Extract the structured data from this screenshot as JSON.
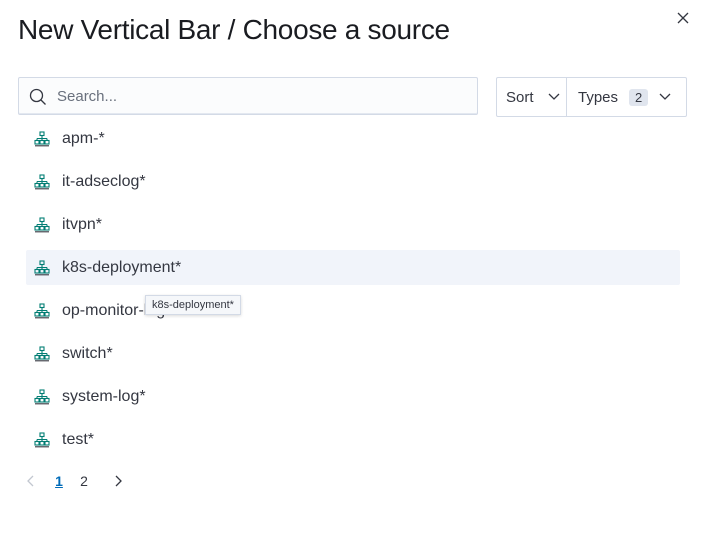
{
  "modal": {
    "title": "New Vertical Bar / Choose a source"
  },
  "search": {
    "placeholder": "Search...",
    "value": ""
  },
  "filters": {
    "sort_label": "Sort",
    "types_label": "Types",
    "types_count": "2"
  },
  "items": [
    {
      "label": "apm-*",
      "icon": "index-pattern-icon"
    },
    {
      "label": "it-adseclog*",
      "icon": "index-pattern-icon"
    },
    {
      "label": "itvpn*",
      "icon": "index-pattern-icon"
    },
    {
      "label": "k8s-deployment*",
      "icon": "index-pattern-icon",
      "hovered": true
    },
    {
      "label": "op-monitor-login",
      "icon": "index-pattern-icon"
    },
    {
      "label": "switch*",
      "icon": "index-pattern-icon"
    },
    {
      "label": "system-log*",
      "icon": "index-pattern-icon"
    },
    {
      "label": "test*",
      "icon": "index-pattern-icon"
    }
  ],
  "tooltip": {
    "text": "k8s-deployment*"
  },
  "pagination": {
    "pages": [
      "1",
      "2"
    ],
    "current": "1"
  },
  "colors": {
    "icon_teal": "#017d73",
    "active_page": "#006bb8",
    "hover_row": "#f1f4fa"
  }
}
